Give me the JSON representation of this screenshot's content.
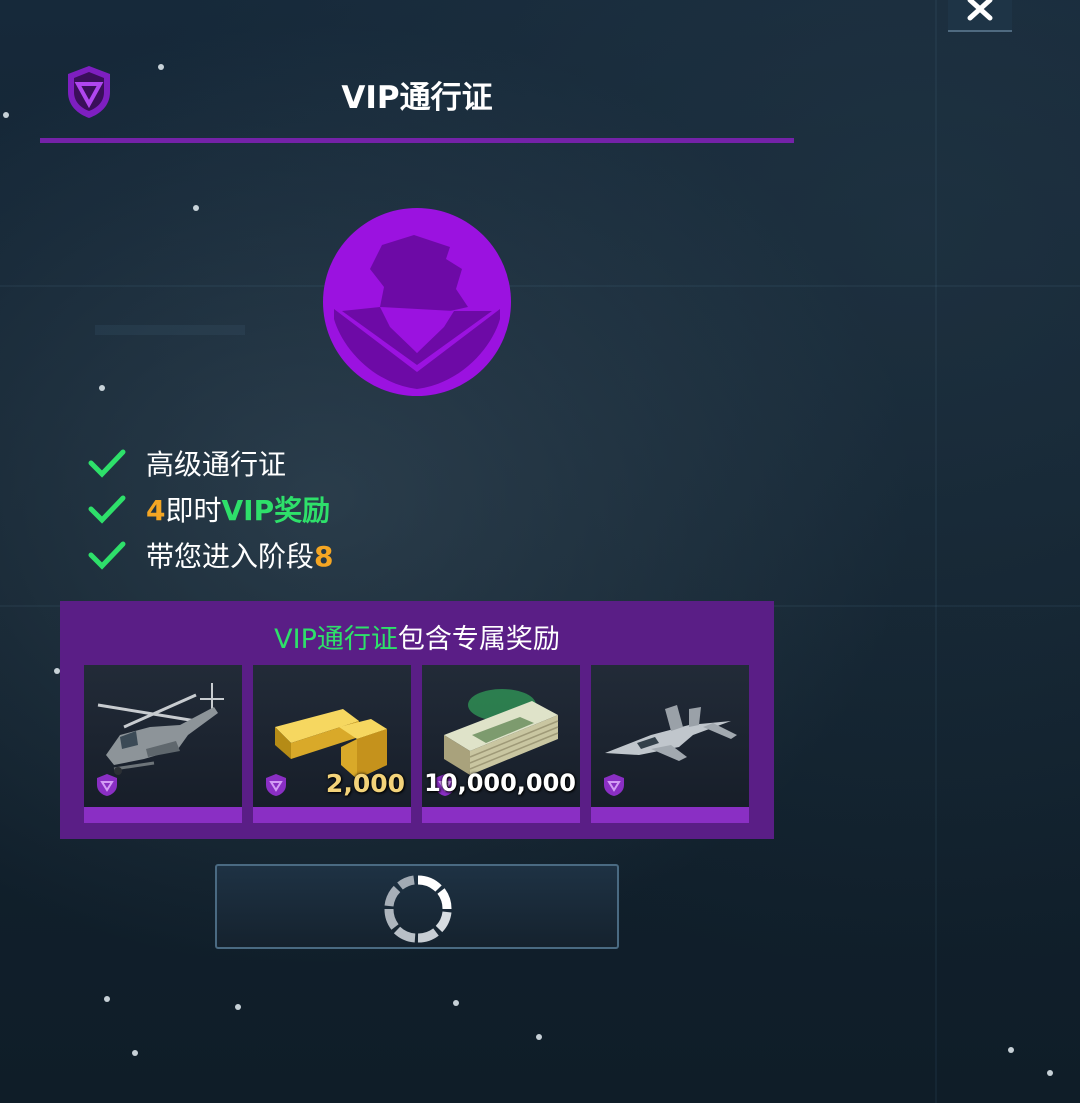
{
  "header": {
    "title": "VIP通行证",
    "shield_icon": "vip-shield-icon",
    "close_icon": "close-icon"
  },
  "emblem": {
    "icon": "eagle-emblem-icon",
    "color": "#9b12e0"
  },
  "features": [
    {
      "icon": "checkmark-icon",
      "text": "高级通行证"
    },
    {
      "icon": "checkmark-icon",
      "highlight": "4",
      "mid": "即时",
      "accent": "VIP奖励"
    },
    {
      "icon": "checkmark-icon",
      "text": "带您进入阶段",
      "highlight": "8"
    }
  ],
  "rewards": {
    "heading_accent": "VIP通行证",
    "heading_rest": "包含专属奖励",
    "items": [
      {
        "icon": "attack-helicopter-icon",
        "qty": ""
      },
      {
        "icon": "gold-bars-icon",
        "qty": "2,000"
      },
      {
        "icon": "cash-stack-icon",
        "qty": "10,000,000"
      },
      {
        "icon": "fighter-jet-icon",
        "qty": ""
      }
    ]
  },
  "action": {
    "icon": "loading-spinner-icon"
  },
  "colors": {
    "accent_purple": "#7422a8",
    "panel_purple": "#5a1e86",
    "check_green": "#2ee06a",
    "highlight_orange": "#f5a623"
  }
}
